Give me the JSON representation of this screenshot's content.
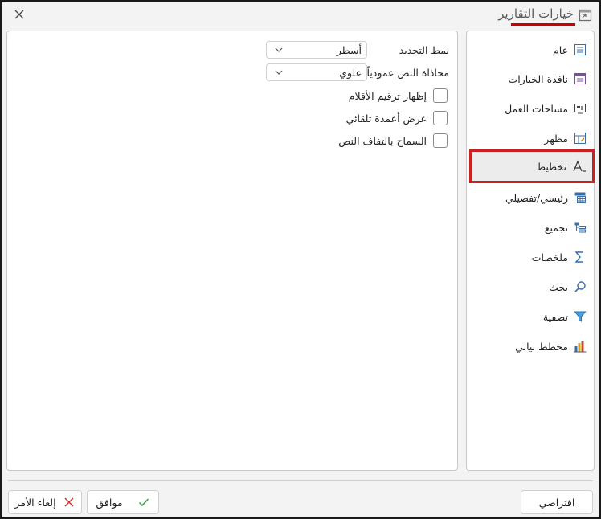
{
  "window": {
    "title": "خيارات التقارير",
    "accent_color": "#cc0000",
    "title_icon": "report-options-icon",
    "close_icon": "close-icon"
  },
  "nav": {
    "items": [
      {
        "label": "عام",
        "icon": "general-list-icon"
      },
      {
        "label": "نافذة الخيارات",
        "icon": "options-window-icon"
      },
      {
        "label": "مساحات العمل",
        "icon": "workspaces-icon"
      },
      {
        "label": "مظهر",
        "icon": "appearance-icon"
      },
      {
        "label": "تخطيط",
        "icon": "layout-font-icon",
        "selected": true
      },
      {
        "label": "رئيسي/تفصيلي",
        "icon": "master-detail-icon"
      },
      {
        "label": "تجميع",
        "icon": "grouping-icon"
      },
      {
        "label": "ملخصات",
        "icon": "sigma-icon"
      },
      {
        "label": "بحث",
        "icon": "search-icon"
      },
      {
        "label": "تصفية",
        "icon": "filter-icon"
      },
      {
        "label": "مخطط بياني",
        "icon": "bar-chart-icon"
      }
    ]
  },
  "layout_settings": {
    "selection_mode": {
      "label": "نمط التحديد",
      "value": "أسطر"
    },
    "vertical_alignment": {
      "label": "محاذاة النص عمودياً",
      "value": "علوي"
    },
    "checkboxes": [
      {
        "label": "إظهار ترقيم الأقلام",
        "checked": false
      },
      {
        "label": "عرض أعمدة تلقائي",
        "checked": false
      },
      {
        "label": "السماح بالتفاف النص",
        "checked": false
      }
    ]
  },
  "footer": {
    "default_button": "افتراضي",
    "ok_button": "موافق",
    "cancel_button": "إلغاء الأمر",
    "ok_color": "#2e9e3e",
    "cancel_color": "#d23030"
  }
}
